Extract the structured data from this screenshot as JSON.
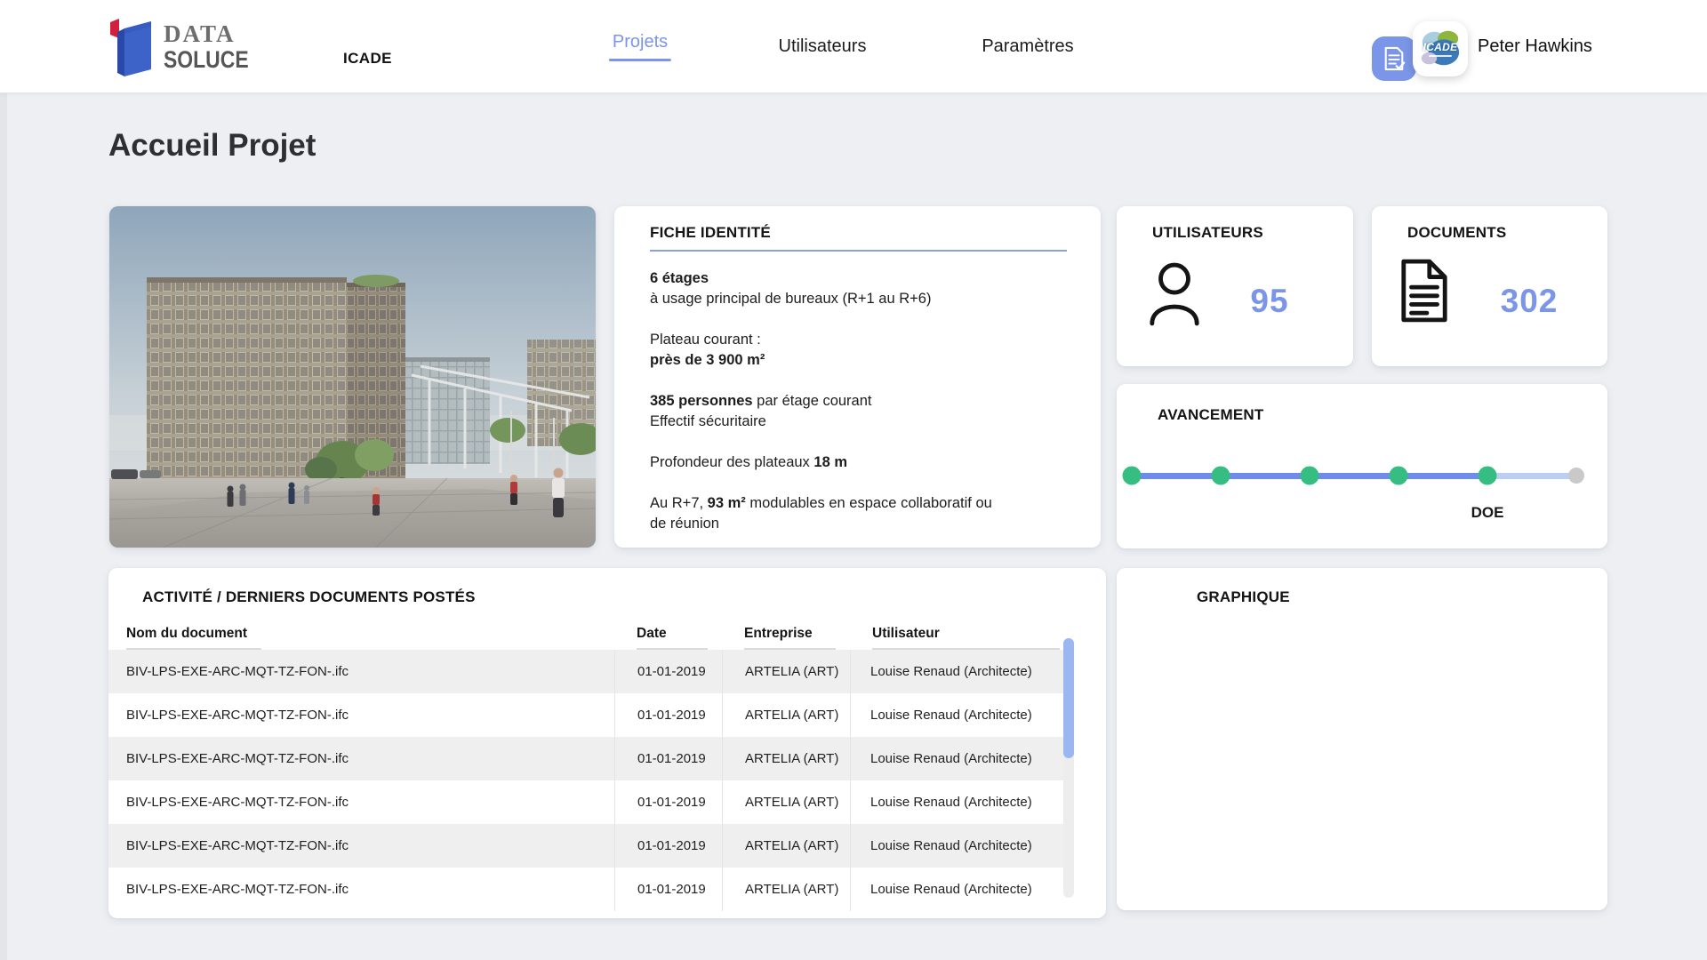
{
  "header": {
    "logo": {
      "line1": "DATA",
      "line2": "SOLUCE",
      "icon": "datasoluce-logo-mark"
    },
    "project_code": "ICADE",
    "nav": [
      {
        "label": "Projets",
        "active": true
      },
      {
        "label": "Utilisateurs",
        "active": false
      },
      {
        "label": "Paramètres",
        "active": false
      }
    ],
    "actions": {
      "doc_button_icon": "document-check-icon"
    },
    "user": {
      "name": "Peter Hawkins",
      "avatar_label": "ICADE"
    }
  },
  "page_title": "Accueil Projet",
  "fiche": {
    "title": "FICHE IDENTITÉ",
    "paragraphs": [
      [
        [
          {
            "t": "6 étages",
            "b": true
          }
        ],
        [
          {
            "t": "à usage principal de bureaux (R+1 au R+6)",
            "b": false
          }
        ]
      ],
      [
        [
          {
            "t": "Plateau courant :",
            "b": false
          }
        ],
        [
          {
            "t": "près de 3 900 m²",
            "b": true
          }
        ]
      ],
      [
        [
          {
            "t": "385 personnes",
            "b": true
          },
          {
            "t": " par étage courant",
            "b": false
          }
        ],
        [
          {
            "t": "Effectif sécuritaire",
            "b": false
          }
        ]
      ],
      [
        [
          {
            "t": "Profondeur des plateaux ",
            "b": false
          },
          {
            "t": "18 m",
            "b": true
          }
        ]
      ],
      [
        [
          {
            "t": "Au R+7, ",
            "b": false
          },
          {
            "t": "93 m²",
            "b": true
          },
          {
            "t": " modulables en espace collaboratif ou",
            "b": false
          }
        ],
        [
          {
            "t": "de réunion",
            "b": false
          }
        ]
      ]
    ]
  },
  "stats": [
    {
      "title": "UTILISATEURS",
      "value": "95",
      "icon": "person-icon"
    },
    {
      "title": "DOCUMENTS",
      "value": "302",
      "icon": "document-icon"
    }
  ],
  "avancement": {
    "title": "AVANCEMENT",
    "steps": [
      "done",
      "done",
      "done",
      "done",
      "done",
      "pending"
    ],
    "milestone_label": "DOE",
    "milestone_index": 4
  },
  "activity": {
    "title": "ACTIVITÉ / DERNIERS DOCUMENTS POSTÉS",
    "columns": [
      "Nom du document",
      "Date",
      "Entreprise",
      "Utilisateur"
    ],
    "rows": [
      [
        "BIV-LPS-EXE-ARC-MQT-TZ-FON-.ifc",
        "01-01-2019",
        "ARTELIA (ART)",
        "Louise Renaud (Architecte)"
      ],
      [
        "BIV-LPS-EXE-ARC-MQT-TZ-FON-.ifc",
        "01-01-2019",
        "ARTELIA (ART)",
        "Louise Renaud (Architecte)"
      ],
      [
        "BIV-LPS-EXE-ARC-MQT-TZ-FON-.ifc",
        "01-01-2019",
        "ARTELIA (ART)",
        "Louise Renaud (Architecte)"
      ],
      [
        "BIV-LPS-EXE-ARC-MQT-TZ-FON-.ifc",
        "01-01-2019",
        "ARTELIA (ART)",
        "Louise Renaud (Architecte)"
      ],
      [
        "BIV-LPS-EXE-ARC-MQT-TZ-FON-.ifc",
        "01-01-2019",
        "ARTELIA (ART)",
        "Louise Renaud (Architecte)"
      ],
      [
        "BIV-LPS-EXE-ARC-MQT-TZ-FON-.ifc",
        "01-01-2019",
        "ARTELIA (ART)",
        "Louise Renaud (Architecte)"
      ]
    ]
  },
  "graphique": {
    "title": "GRAPHIQUE"
  },
  "colors": {
    "accent": "#7b96e8",
    "fiche_underline": "#8b9fe4",
    "green": "#35bd82",
    "step_line": "#6d8ceb",
    "step_line_light": "#bdcef5",
    "step_pending": "#c9c9c9",
    "row_alt": "#efefef",
    "scrollbar_thumb": "#9cb7f0"
  }
}
